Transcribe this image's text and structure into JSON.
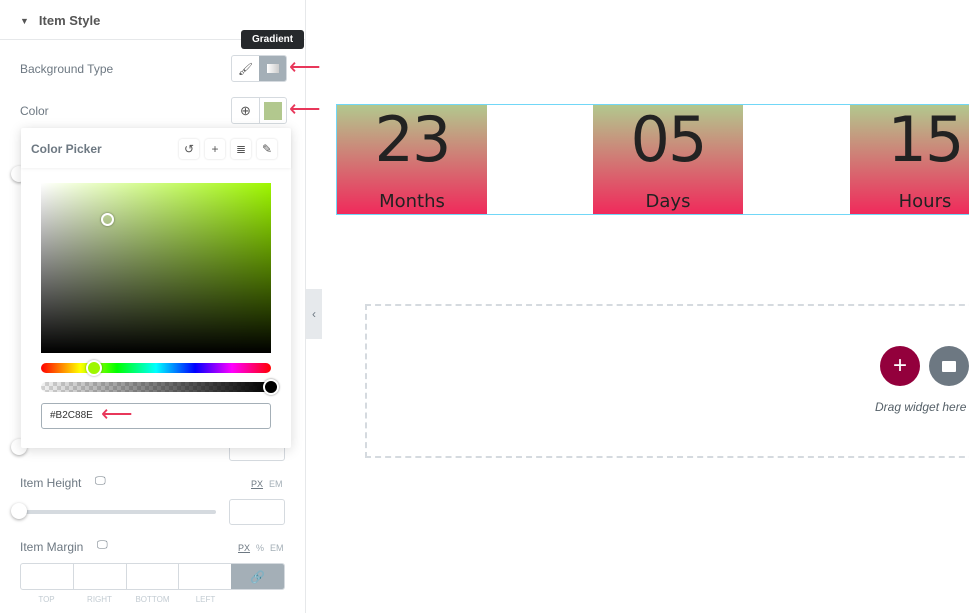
{
  "section": {
    "title": "Item Style"
  },
  "background_type": {
    "label": "Background Type",
    "tooltip": "Gradient",
    "options": [
      "classic-brush-icon",
      "gradient-icon"
    ],
    "selected": "Gradient"
  },
  "color": {
    "label": "Color",
    "swatch": "#B2C88E"
  },
  "color_picker": {
    "title": "Color Picker",
    "hex_value": "#B2C88E",
    "hue_color": "#9ef700"
  },
  "item_height": {
    "label": "Item Height",
    "units": [
      "PX",
      "EM"
    ],
    "active_unit": "PX",
    "value": ""
  },
  "item_margin": {
    "label": "Item Margin",
    "units": [
      "PX",
      "%",
      "EM"
    ],
    "active_unit": "PX",
    "fields": [
      "TOP",
      "RIGHT",
      "BOTTOM",
      "LEFT"
    ]
  },
  "countdown": {
    "items": [
      {
        "value": "23",
        "label": "Months"
      },
      {
        "value": "05",
        "label": "Days"
      },
      {
        "value": "15",
        "label": "Hours"
      }
    ],
    "gradient": [
      "#b2c88e",
      "#f02a5b"
    ]
  },
  "dropzone": {
    "text": "Drag widget here"
  },
  "colors": {
    "accent": "#93003c",
    "arrow": "#e8375a"
  }
}
